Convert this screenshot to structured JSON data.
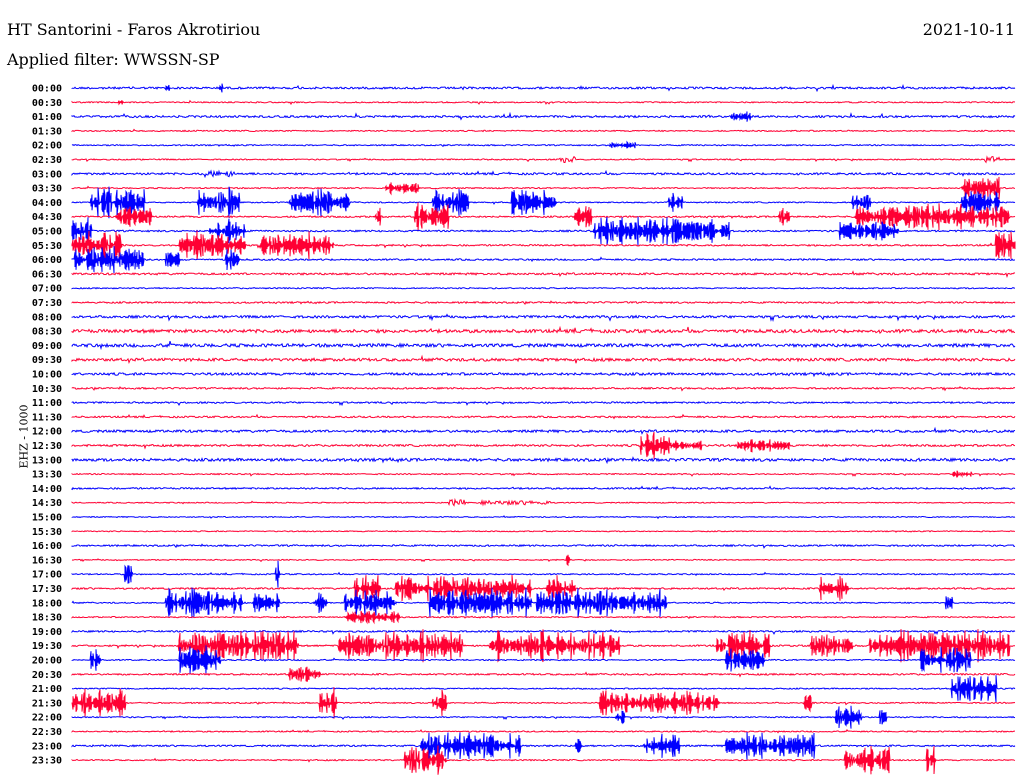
{
  "header": {
    "title": "HT Santorini - Faros Akrotiriou",
    "date": "2021-10-11",
    "filter": "Applied filter: WWSSN-SP",
    "channel": "EHZ - 1000"
  },
  "chart_data": {
    "type": "line",
    "title": "HT Santorini - Faros Akrotiriou",
    "subtitle": "Applied filter: WWSSN-SP",
    "ylabel": "EHZ - 1000",
    "xlabel": "",
    "minutes_per_row": 30,
    "colors": [
      "#0000ff",
      "#ff0033"
    ],
    "row_labels": [
      "00:00",
      "00:30",
      "01:00",
      "01:30",
      "02:00",
      "02:30",
      "03:00",
      "03:30",
      "04:00",
      "04:30",
      "05:00",
      "05:30",
      "06:00",
      "06:30",
      "07:00",
      "07:30",
      "08:00",
      "08:30",
      "09:00",
      "09:30",
      "10:00",
      "10:30",
      "11:00",
      "11:30",
      "12:00",
      "12:30",
      "13:00",
      "13:30",
      "14:00",
      "14:30",
      "15:00",
      "15:30",
      "16:00",
      "16:30",
      "17:00",
      "17:30",
      "18:00",
      "18:30",
      "19:00",
      "19:30",
      "20:00",
      "20:30",
      "21:00",
      "21:30",
      "22:00",
      "22:30",
      "23:00",
      "23:30"
    ],
    "noise": [
      1,
      0.6,
      1,
      0.6,
      0.6,
      0.6,
      1,
      0.6,
      0.6,
      0.8,
      0.8,
      0.8,
      0.8,
      1,
      0.6,
      0.8,
      1.2,
      1.6,
      1.6,
      1.4,
      1.2,
      0.8,
      0.8,
      0.8,
      1.2,
      1.0,
      1.4,
      0.6,
      0.8,
      0.5,
      0.5,
      0.5,
      0.8,
      0.5,
      0.6,
      0.8,
      0.6,
      0.6,
      0.8,
      0.8,
      0.6,
      0.8,
      0.6,
      0.6,
      0.6,
      0.6,
      0.8,
      0.6
    ],
    "events": [
      [
        0,
        3.0,
        3.1,
        6
      ],
      [
        0,
        4.7,
        4.8,
        6
      ],
      [
        1,
        1.5,
        1.6,
        4
      ],
      [
        2,
        21.0,
        21.6,
        6
      ],
      [
        4,
        17.1,
        17.9,
        4
      ],
      [
        5,
        15.5,
        16.0,
        3
      ],
      [
        5,
        29.0,
        29.5,
        3
      ],
      [
        6,
        4.2,
        5.2,
        3
      ],
      [
        7,
        10.0,
        11.0,
        6
      ],
      [
        7,
        28.3,
        29.5,
        14
      ],
      [
        8,
        0.6,
        2.3,
        16
      ],
      [
        8,
        4.0,
        5.3,
        16
      ],
      [
        8,
        6.9,
        8.8,
        16
      ],
      [
        8,
        11.5,
        12.6,
        14
      ],
      [
        8,
        14.0,
        15.4,
        16
      ],
      [
        8,
        19.0,
        19.4,
        14
      ],
      [
        8,
        24.8,
        25.4,
        10
      ],
      [
        8,
        28.3,
        29.5,
        14
      ],
      [
        9,
        1.4,
        2.5,
        14
      ],
      [
        9,
        9.6,
        9.8,
        12
      ],
      [
        9,
        10.9,
        12.0,
        16
      ],
      [
        9,
        16.0,
        16.5,
        12
      ],
      [
        9,
        22.5,
        22.8,
        10
      ],
      [
        9,
        24.9,
        29.8,
        14
      ],
      [
        10,
        0,
        0.6,
        14
      ],
      [
        10,
        4.4,
        5.5,
        14
      ],
      [
        10,
        16.6,
        20.0,
        16
      ],
      [
        10,
        20.1,
        20.9,
        14
      ],
      [
        10,
        24.4,
        26.3,
        14
      ],
      [
        11,
        0,
        1.6,
        16
      ],
      [
        11,
        3.4,
        5.5,
        16
      ],
      [
        11,
        6.0,
        8.3,
        14
      ],
      [
        11,
        29.4,
        30,
        16
      ],
      [
        12,
        0.1,
        2.3,
        14
      ],
      [
        12,
        3.0,
        3.4,
        14
      ],
      [
        12,
        4.9,
        5.3,
        12
      ],
      [
        25,
        18.1,
        19.0,
        16
      ],
      [
        25,
        19.0,
        20.0,
        7
      ],
      [
        25,
        21.2,
        22.8,
        7
      ],
      [
        27,
        28.0,
        28.6,
        4
      ],
      [
        29,
        12.0,
        12.5,
        3
      ],
      [
        29,
        13.0,
        15.2,
        2
      ],
      [
        33,
        15.7,
        15.8,
        14
      ],
      [
        34,
        1.7,
        1.9,
        14
      ],
      [
        34,
        6.5,
        6.6,
        14
      ],
      [
        35,
        9.0,
        9.8,
        16
      ],
      [
        35,
        10.3,
        14.6,
        16
      ],
      [
        35,
        15.1,
        16.0,
        14
      ],
      [
        35,
        23.8,
        24.7,
        14
      ],
      [
        36,
        3.0,
        5.4,
        16
      ],
      [
        36,
        5.8,
        6.6,
        12
      ],
      [
        36,
        7.7,
        8.1,
        12
      ],
      [
        36,
        8.7,
        10.3,
        16
      ],
      [
        36,
        11.4,
        14.6,
        16
      ],
      [
        36,
        14.8,
        18.9,
        16
      ],
      [
        36,
        27.8,
        28.0,
        10
      ],
      [
        37,
        8.7,
        10.4,
        8
      ],
      [
        39,
        3.4,
        7.2,
        18
      ],
      [
        39,
        8.5,
        12.4,
        18
      ],
      [
        39,
        13.3,
        17.4,
        18
      ],
      [
        39,
        20.5,
        22.2,
        16
      ],
      [
        39,
        23.5,
        24.8,
        14
      ],
      [
        39,
        25.4,
        29.8,
        18
      ],
      [
        40,
        0.6,
        0.9,
        16
      ],
      [
        40,
        3.4,
        4.7,
        16
      ],
      [
        40,
        20.8,
        22.0,
        14
      ],
      [
        40,
        27.0,
        28.6,
        16
      ],
      [
        41,
        6.9,
        7.9,
        9
      ],
      [
        42,
        28.0,
        29.4,
        16
      ],
      [
        43,
        0,
        1.7,
        16
      ],
      [
        43,
        7.9,
        8.4,
        16
      ],
      [
        43,
        11.5,
        11.9,
        16
      ],
      [
        43,
        16.8,
        20.6,
        14
      ],
      [
        43,
        23.3,
        23.5,
        12
      ],
      [
        44,
        17.3,
        17.6,
        10
      ],
      [
        44,
        24.3,
        25.1,
        14
      ],
      [
        44,
        25.7,
        25.9,
        12
      ],
      [
        46,
        11.1,
        14.3,
        16
      ],
      [
        46,
        16.0,
        16.2,
        14
      ],
      [
        46,
        18.2,
        19.3,
        14
      ],
      [
        46,
        20.8,
        23.6,
        16
      ],
      [
        47,
        10.6,
        11.9,
        18
      ],
      [
        47,
        24.6,
        26.0,
        18
      ],
      [
        47,
        27.2,
        27.5,
        16
      ]
    ]
  }
}
